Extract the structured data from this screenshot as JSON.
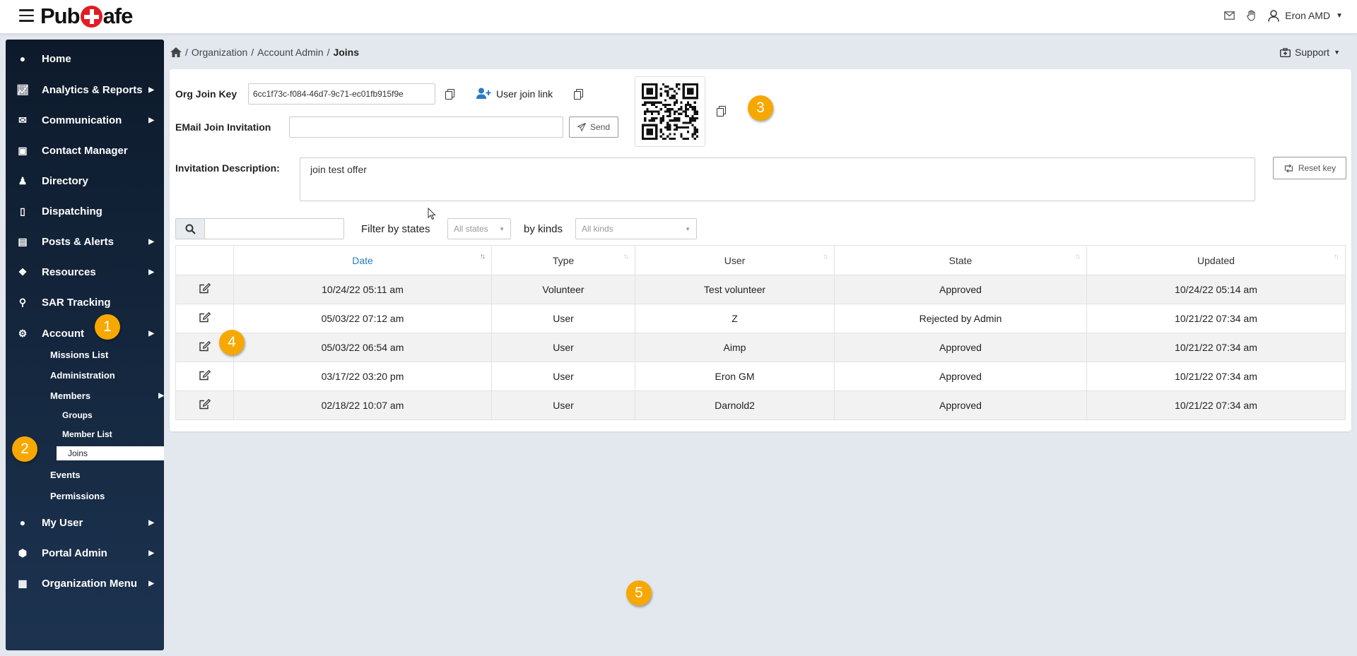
{
  "app": {
    "logo_left": "Pub",
    "logo_right": "afe"
  },
  "topbar": {
    "user_name": "Eron AMD",
    "icons": [
      "mail-icon",
      "hand-icon",
      "user-icon"
    ]
  },
  "sidebar": {
    "items": [
      {
        "label": "Home",
        "icon": "globe-icon",
        "arrow": false
      },
      {
        "label": "Analytics & Reports",
        "icon": "chart-icon",
        "arrow": true
      },
      {
        "label": "Communication",
        "icon": "envelope-icon",
        "arrow": true
      },
      {
        "label": "Contact Manager",
        "icon": "address-book-icon",
        "arrow": false
      },
      {
        "label": "Directory",
        "icon": "users-icon",
        "arrow": false
      },
      {
        "label": "Dispatching",
        "icon": "mobile-icon",
        "arrow": false
      },
      {
        "label": "Posts & Alerts",
        "icon": "map-icon",
        "arrow": true
      },
      {
        "label": "Resources",
        "icon": "cubes-icon",
        "arrow": true
      },
      {
        "label": "SAR Tracking",
        "icon": "route-icon",
        "arrow": false
      },
      {
        "label": "Account",
        "icon": "gear-icon",
        "arrow": true
      },
      {
        "label": "My User",
        "icon": "user-icon",
        "arrow": true
      },
      {
        "label": "Portal Admin",
        "icon": "cog-shield-icon",
        "arrow": true
      },
      {
        "label": "Organization Menu",
        "icon": "building-icon",
        "arrow": true
      }
    ],
    "account_sub": {
      "missions": "Missions List",
      "administration": "Administration",
      "members": "Members",
      "groups": "Groups",
      "member_list": "Member List",
      "joins": "Joins",
      "events": "Events",
      "permissions": "Permissions"
    }
  },
  "breadcrumb": {
    "items": [
      "Organization",
      "Account Admin"
    ],
    "current": "Joins",
    "separator": "/"
  },
  "support": {
    "label": "Support"
  },
  "form": {
    "org_join_key_label": "Org Join Key",
    "org_join_key_value": "6cc1f73c-f084-46d7-9c71-ec01fb915f9e",
    "user_join_link_label": "User join link",
    "email_invite_label": "EMail Join Invitation",
    "email_invite_value": "",
    "send_label": "Send",
    "description_label": "Invitation Description:",
    "description_value": "join test offer",
    "reset_key_label": "Reset key"
  },
  "filters": {
    "search_value": "",
    "filter_states_label": "Filter by states",
    "states_selected": "All states",
    "kinds_label": "by kinds",
    "kinds_selected": "All kinds"
  },
  "table": {
    "columns": [
      "Date",
      "Type",
      "User",
      "State",
      "Updated"
    ],
    "sorted_column": "Date",
    "rows": [
      {
        "date": "10/24/22 05:11 am",
        "type": "Volunteer",
        "user": "Test volunteer",
        "state": "Approved",
        "updated": "10/24/22 05:14 am"
      },
      {
        "date": "05/03/22 07:12 am",
        "type": "User",
        "user": "Z",
        "state": "Rejected by Admin",
        "updated": "10/21/22 07:34 am"
      },
      {
        "date": "05/03/22 06:54 am",
        "type": "User",
        "user": "Aimp",
        "state": "Approved",
        "updated": "10/21/22 07:34 am"
      },
      {
        "date": "03/17/22 03:20 pm",
        "type": "User",
        "user": "Eron GM",
        "state": "Approved",
        "updated": "10/21/22 07:34 am"
      },
      {
        "date": "02/18/22 10:07 am",
        "type": "User",
        "user": "Darnold2",
        "state": "Approved",
        "updated": "10/21/22 07:34 am"
      }
    ]
  },
  "badges": [
    "1",
    "2",
    "3",
    "4",
    "5"
  ],
  "colors": {
    "sidebar_top": "#0d1a2b",
    "sidebar_bottom": "#1c3350",
    "badge": "#f6a800",
    "link": "#2a7bbf",
    "logo_red": "#e31b23"
  }
}
